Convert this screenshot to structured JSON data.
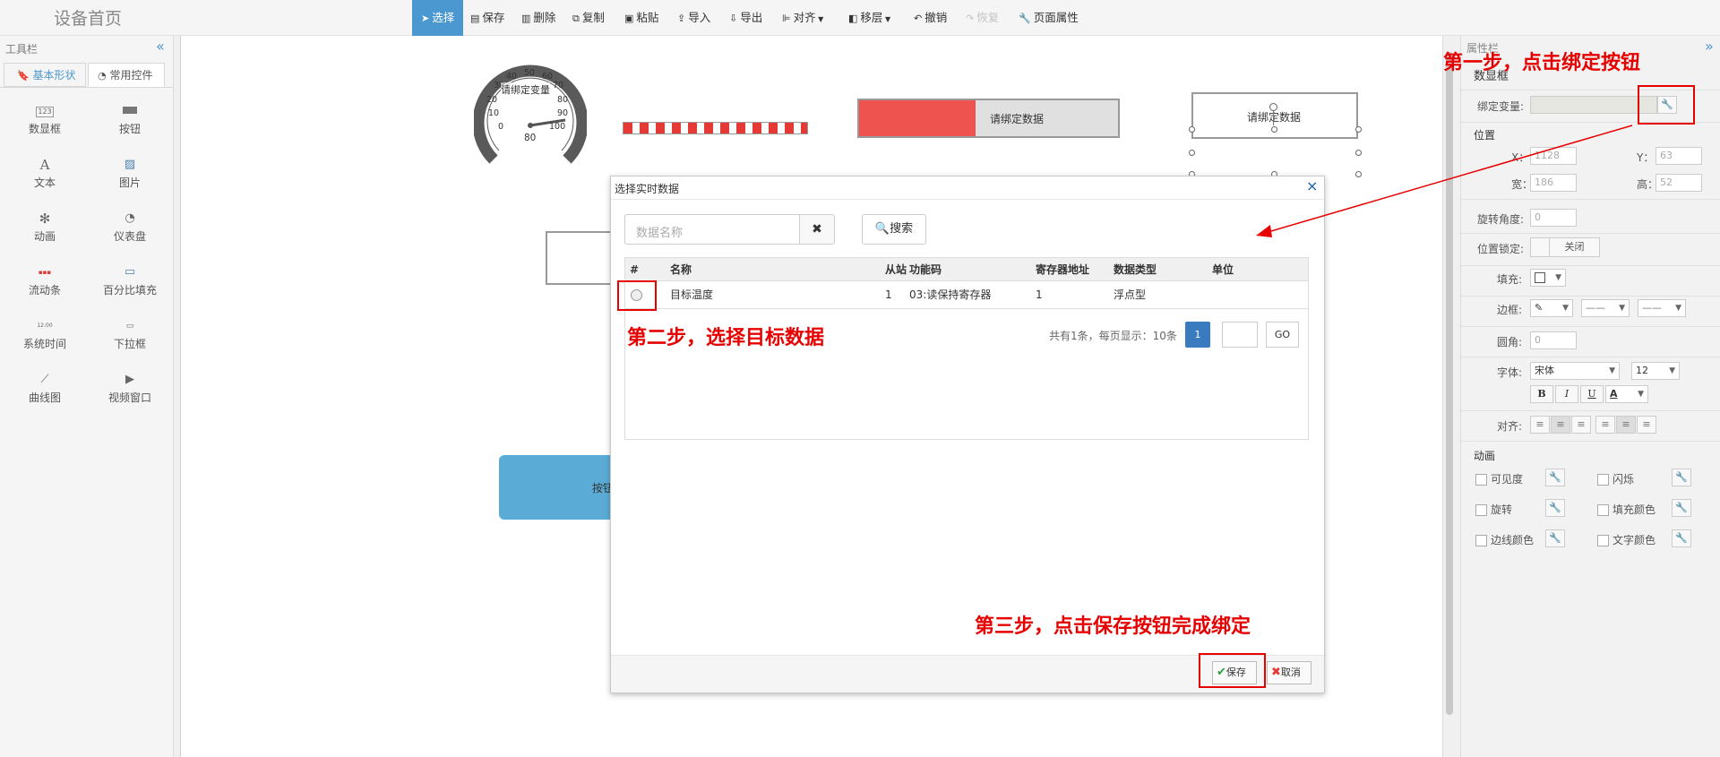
{
  "app": {
    "title": "设备首页"
  },
  "toolbar": {
    "items": [
      {
        "label": "选择",
        "icon": "cursor-icon"
      },
      {
        "label": "保存",
        "icon": "save-icon"
      },
      {
        "label": "删除",
        "icon": "trash-icon"
      },
      {
        "label": "复制",
        "icon": "copy-icon"
      },
      {
        "label": "粘贴",
        "icon": "paste-icon"
      },
      {
        "label": "导入",
        "icon": "import-icon"
      },
      {
        "label": "导出",
        "icon": "export-icon"
      },
      {
        "label": "对齐",
        "icon": "align-icon"
      },
      {
        "label": "移层",
        "icon": "layer-icon"
      },
      {
        "label": "撤销",
        "icon": "undo-icon"
      },
      {
        "label": "恢复",
        "icon": "redo-icon"
      },
      {
        "label": "页面属性",
        "icon": "wrench-icon"
      }
    ]
  },
  "left_panel": {
    "title": "工具栏",
    "collapse_glyph": "«",
    "tabs": [
      {
        "label": "基本形状"
      },
      {
        "label": "常用控件"
      }
    ],
    "tools": [
      {
        "label": "数显框",
        "icon": "numeric-display-icon",
        "glyph": "123"
      },
      {
        "label": "按钮",
        "icon": "button-icon",
        "glyph": "▬"
      },
      {
        "label": "文本",
        "icon": "text-icon",
        "glyph": "A"
      },
      {
        "label": "图片",
        "icon": "image-icon",
        "glyph": "▨"
      },
      {
        "label": "动画",
        "icon": "fan-icon",
        "glyph": "✻"
      },
      {
        "label": "仪表盘",
        "icon": "gauge-icon",
        "glyph": "◔"
      },
      {
        "label": "流动条",
        "icon": "flow-bar-icon",
        "glyph": "▪▪▪"
      },
      {
        "label": "百分比填充",
        "icon": "percent-fill-icon",
        "glyph": "▭"
      },
      {
        "label": "系统时间",
        "icon": "clock-icon",
        "glyph": "12:00"
      },
      {
        "label": "下拉框",
        "icon": "dropdown-icon",
        "glyph": "▭"
      },
      {
        "label": "曲线图",
        "icon": "line-chart-icon",
        "glyph": "⟋"
      },
      {
        "label": "视频窗口",
        "icon": "video-play-icon",
        "glyph": "▶"
      }
    ]
  },
  "canvas": {
    "gauge": {
      "label": "请绑定变量",
      "ticks": [
        "0",
        "10",
        "20",
        "30",
        "40",
        "50",
        "60",
        "70",
        "80",
        "90",
        "100"
      ],
      "bottom_value": "80"
    },
    "percent_fill": {
      "label": "请绑定数据",
      "fill_fraction": 0.45
    },
    "selected_box": {
      "label": "请绑定数据"
    },
    "button_partial": {
      "label": "按钮"
    }
  },
  "right_panel": {
    "title": "属性栏",
    "collapse_glyph": "»",
    "section_title": "数显框",
    "bind_var_label": "绑定变量:",
    "bind_var_value": "",
    "position_title": "位置",
    "x_label": "X：",
    "x_value": "1128",
    "y_label": "Y：",
    "y_value": "63",
    "w_label": "宽：",
    "w_value": "186",
    "h_label": "高：",
    "h_value": "52",
    "rotate_label": "旋转角度:",
    "rotate_value": "0",
    "lock_label": "位置锁定:",
    "lock_value": "关闭",
    "fill_label": "填充:",
    "border_label": "边框:",
    "radius_label": "圆角:",
    "radius_value": "0",
    "font_label": "字体:",
    "font_value": "宋体",
    "font_size": "12",
    "bold": "B",
    "italic": "I",
    "underline": "U",
    "font_color": "A",
    "align_label": "对齐:",
    "anim_title": "动画",
    "anims": [
      {
        "label": "可见度"
      },
      {
        "label": "闪烁"
      },
      {
        "label": "旋转"
      },
      {
        "label": "填充颜色"
      },
      {
        "label": "边线颜色"
      },
      {
        "label": "文字颜色"
      }
    ]
  },
  "modal": {
    "title": "选择实时数据",
    "close_glyph": "×",
    "search_placeholder": "数据名称",
    "clear_glyph": "✖",
    "search_button": "搜索",
    "headers": [
      "#",
      "名称",
      "从站",
      "功能码",
      "寄存器地址",
      "数据类型",
      "单位"
    ],
    "rows": [
      {
        "name": "目标温度",
        "slave": "1",
        "func": "03:读保持寄存器",
        "addr": "1",
        "type": "浮点型",
        "unit": ""
      }
    ],
    "pagination_info": "共有1条，每页显示：10条",
    "current_page": "1",
    "go_label": "GO",
    "save_label": "保存",
    "cancel_label": "取消"
  },
  "annotations": {
    "step1": "第一步，点击绑定按钮",
    "step2": "第二步，选择目标数据",
    "step3": "第三步，点击保存按钮完成绑定"
  },
  "colors": {
    "accent": "#4b97cf",
    "red_fill": "#ef5350",
    "annotation": "#e60000"
  }
}
